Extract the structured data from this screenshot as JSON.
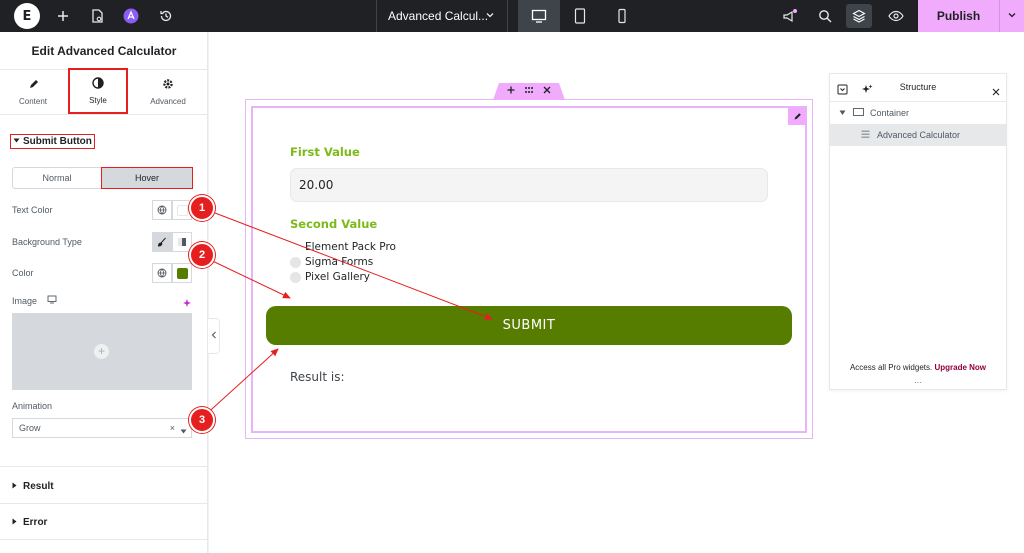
{
  "topbar": {
    "logo": "E",
    "doc_title": "Advanced Calcul...",
    "publish_label": "Publish"
  },
  "panel": {
    "title": "Edit Advanced Calculator",
    "tabs": [
      {
        "label": "Content",
        "icon": "pencil-icon"
      },
      {
        "label": "Style",
        "icon": "half-circle-icon"
      },
      {
        "label": "Advanced",
        "icon": "gear-icon"
      }
    ],
    "section": "Submit Button",
    "state_tabs": [
      "Normal",
      "Hover"
    ],
    "text_color_label": "Text Color",
    "bg_type_label": "Background Type",
    "color_label": "Color",
    "image_label": "Image",
    "animation_label": "Animation",
    "animation_value": "Grow",
    "collapsed_sections": [
      "Result",
      "Error"
    ],
    "accent_color": "#567d00"
  },
  "calculator": {
    "first_label": "First Value",
    "first_value": "20.00",
    "second_label": "Second Value",
    "options": [
      "Element Pack Pro",
      "Sigma Forms",
      "Pixel Gallery"
    ],
    "submit_label": "SUBMIT",
    "result_label": "Result is:",
    "button_color": "#567d00",
    "label_color": "#7cba1a"
  },
  "structure": {
    "title": "Structure",
    "items": [
      "Container",
      "Advanced Calculator"
    ],
    "footer_text": "Access all Pro widgets.",
    "footer_link": "Upgrade Now"
  },
  "callouts": [
    "1",
    "2",
    "3"
  ]
}
